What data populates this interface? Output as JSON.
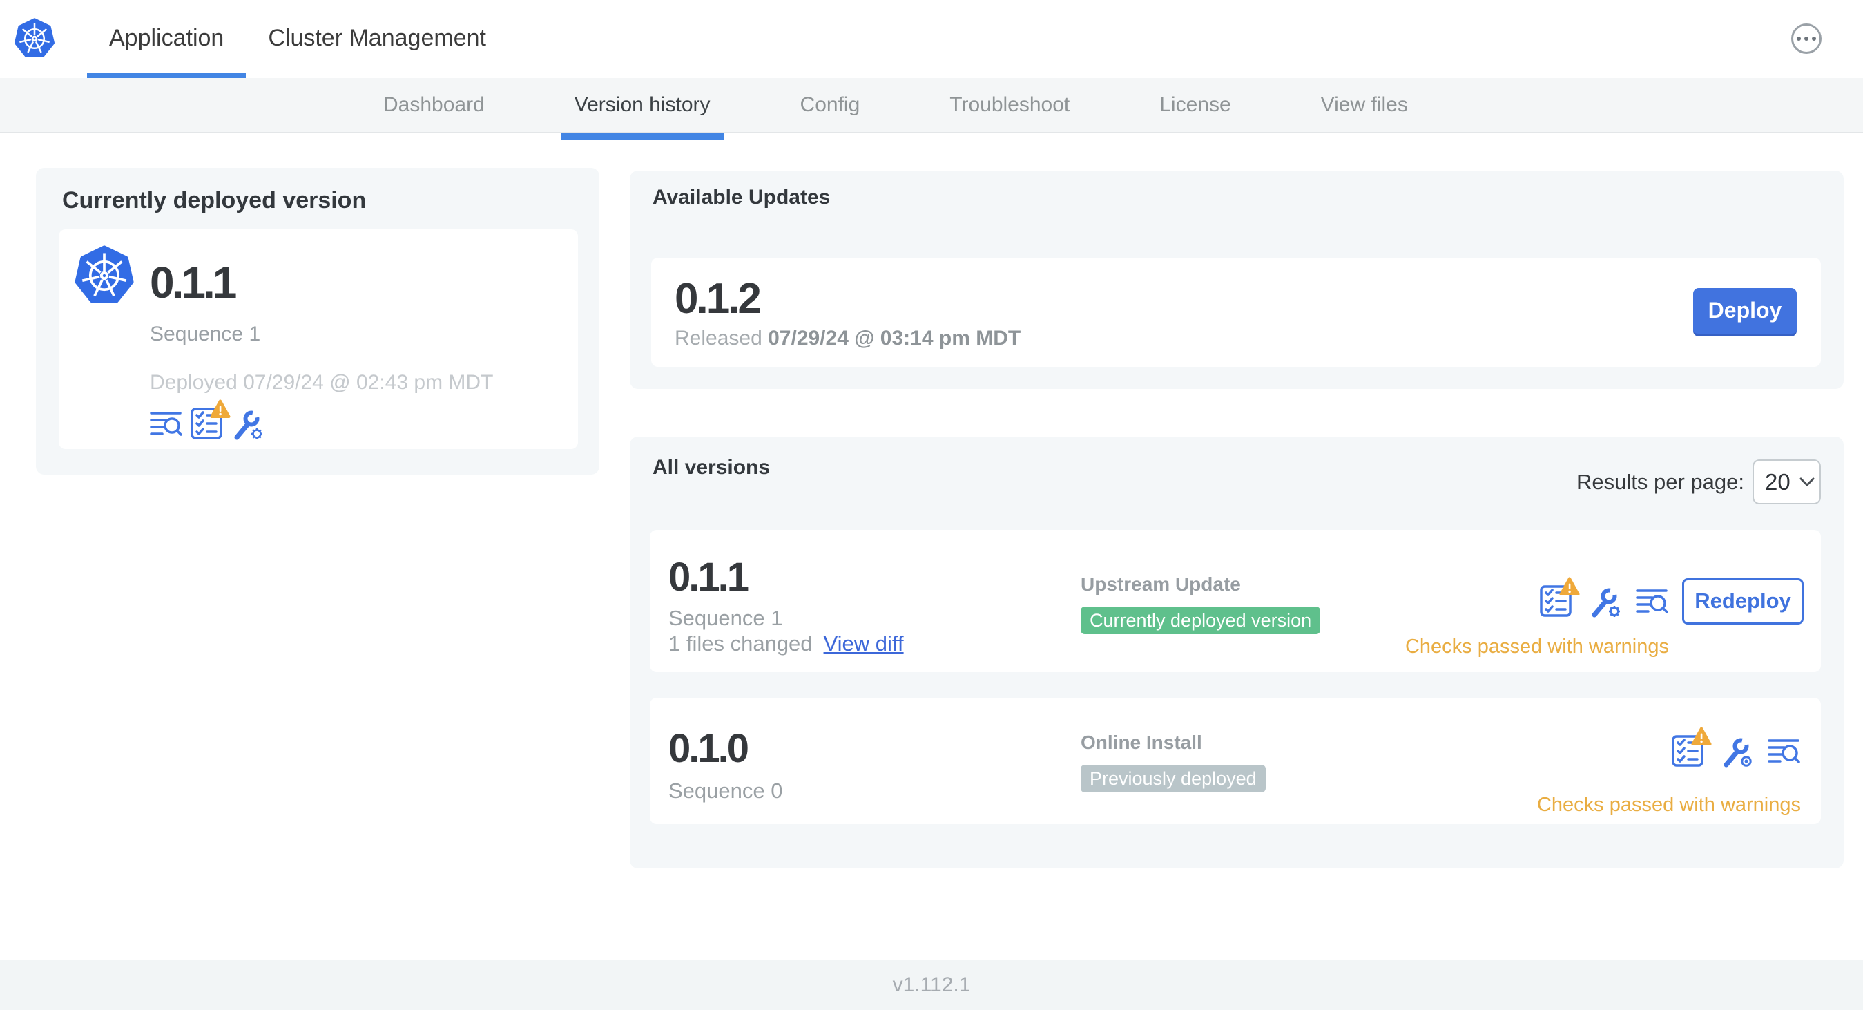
{
  "topbar": {
    "tabs": [
      {
        "label": "Application",
        "active": true
      },
      {
        "label": "Cluster Management",
        "active": false
      }
    ]
  },
  "subnav": {
    "items": [
      {
        "label": "Dashboard",
        "active": false
      },
      {
        "label": "Version history",
        "active": true
      },
      {
        "label": "Config",
        "active": false
      },
      {
        "label": "Troubleshoot",
        "active": false
      },
      {
        "label": "License",
        "active": false
      },
      {
        "label": "View files",
        "active": false
      }
    ]
  },
  "currently_deployed": {
    "title": "Currently deployed version",
    "version": "0.1.1",
    "sequence": "Sequence 1",
    "deployed": "Deployed 07/29/24 @ 02:43 pm MDT"
  },
  "available_updates": {
    "title": "Available Updates",
    "version": "0.1.2",
    "released_label": "Released",
    "released_date": "07/29/24 @ 03:14 pm MDT",
    "deploy_label": "Deploy"
  },
  "all_versions": {
    "title": "All versions",
    "results_per_page_label": "Results per page:",
    "results_per_page_value": "20",
    "rows": [
      {
        "version": "0.1.1",
        "sequence": "Sequence 1",
        "files_changed": "1 files changed",
        "view_diff": "View diff",
        "source": "Upstream Update",
        "badge": "Currently deployed version",
        "badge_type": "green",
        "status": "Checks passed with warnings",
        "action": "Redeploy"
      },
      {
        "version": "0.1.0",
        "sequence": "Sequence 0",
        "source": "Online Install",
        "badge": "Previously deployed",
        "badge_type": "gray",
        "status": "Checks passed with warnings"
      }
    ]
  },
  "footer": {
    "version": "v1.112.1"
  },
  "colors": {
    "accent_blue": "#4285e4",
    "button_blue": "#4173df",
    "link_blue": "#3c67d9",
    "badge_green": "#5fc08c",
    "badge_gray": "#b9c5c9",
    "warning_orange": "#efa93a",
    "logo_blue": "#326ce5"
  }
}
